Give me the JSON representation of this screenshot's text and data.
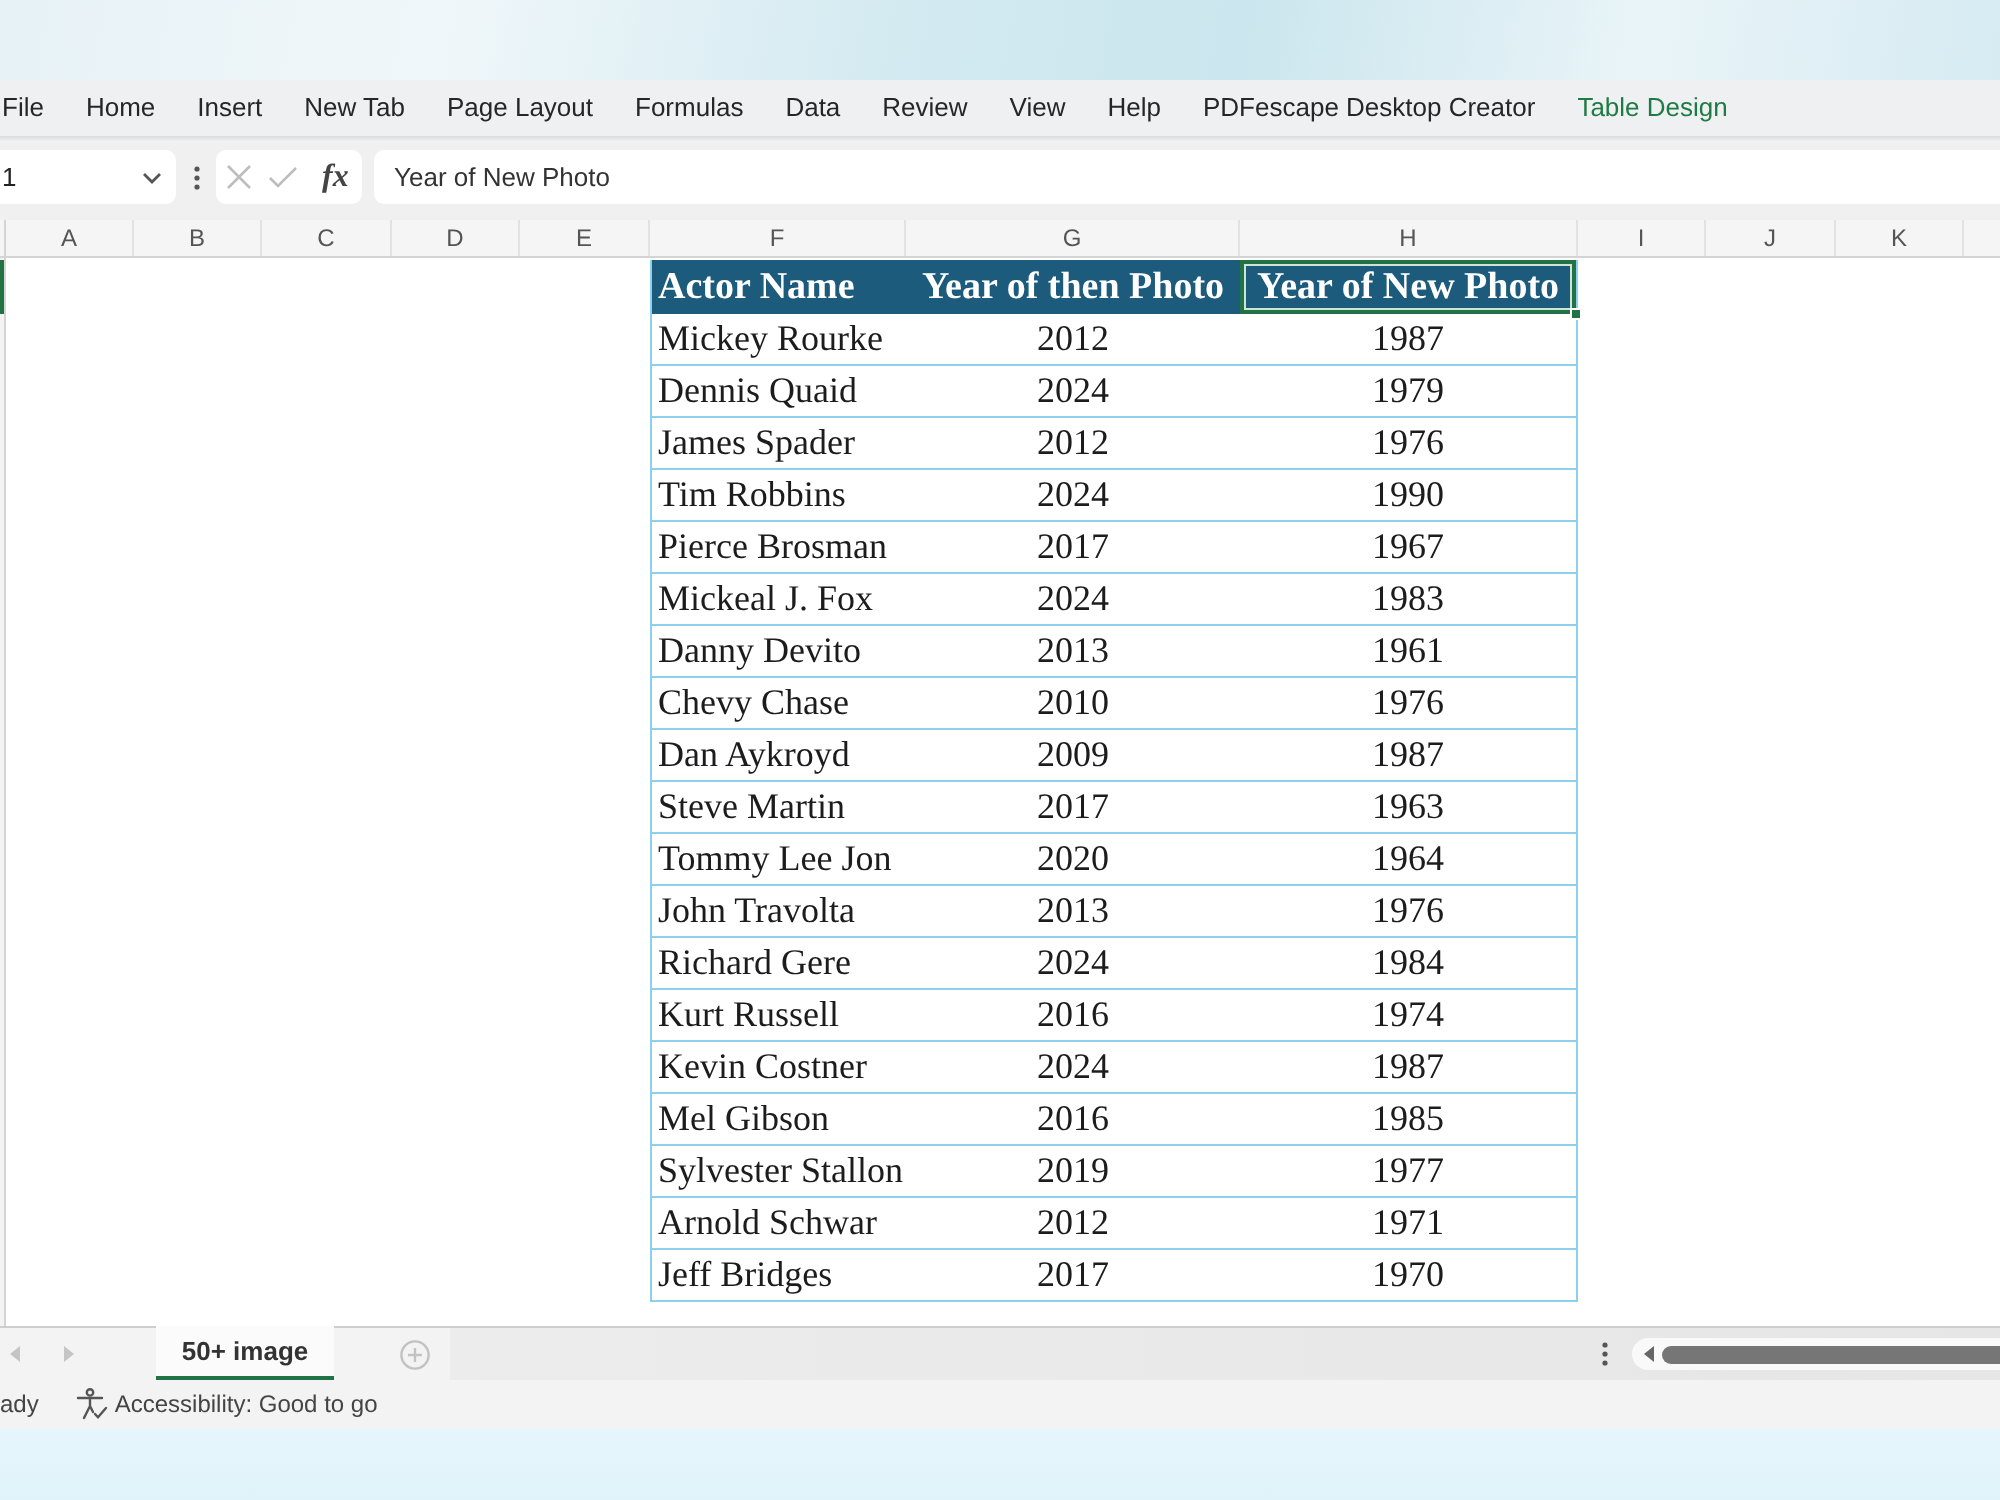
{
  "ribbon": {
    "tabs": [
      {
        "label": "File",
        "kind": "standard"
      },
      {
        "label": "Home",
        "kind": "standard"
      },
      {
        "label": "Insert",
        "kind": "standard"
      },
      {
        "label": "New Tab",
        "kind": "standard"
      },
      {
        "label": "Page Layout",
        "kind": "standard"
      },
      {
        "label": "Formulas",
        "kind": "standard"
      },
      {
        "label": "Data",
        "kind": "standard"
      },
      {
        "label": "Review",
        "kind": "standard"
      },
      {
        "label": "View",
        "kind": "standard"
      },
      {
        "label": "Help",
        "kind": "standard"
      },
      {
        "label": "PDFescape Desktop Creator",
        "kind": "standard"
      },
      {
        "label": "Table Design",
        "kind": "contextual"
      }
    ]
  },
  "formula_bar": {
    "name_box": "1",
    "function_label": "fx",
    "formula": "Year of New Photo"
  },
  "grid": {
    "column_letters": [
      "A",
      "B",
      "C",
      "D",
      "E",
      "F",
      "G",
      "H",
      "I",
      "J",
      "K"
    ]
  },
  "table": {
    "columns": [
      {
        "label": "Actor Name",
        "selected": false
      },
      {
        "label": "Year of then Photo",
        "selected": false
      },
      {
        "label": "Year of New Photo",
        "selected": true
      }
    ],
    "rows": [
      [
        "Mickey Rourke",
        "2012",
        "1987"
      ],
      [
        "Dennis Quaid",
        "2024",
        "1979"
      ],
      [
        "James Spader",
        "2012",
        "1976"
      ],
      [
        "Tim Robbins",
        "2024",
        "1990"
      ],
      [
        "Pierce Brosman",
        "2017",
        "1967"
      ],
      [
        "Mickeal J. Fox",
        "2024",
        "1983"
      ],
      [
        "Danny Devito",
        "2013",
        "1961"
      ],
      [
        "Chevy Chase",
        "2010",
        "1976"
      ],
      [
        "Dan Aykroyd",
        "2009",
        "1987"
      ],
      [
        "Steve Martin",
        "2017",
        "1963"
      ],
      [
        "Tommy Lee Jon",
        "2020",
        "1964"
      ],
      [
        "John Travolta",
        "2013",
        "1976"
      ],
      [
        "Richard Gere",
        "2024",
        "1984"
      ],
      [
        "Kurt Russell",
        "2016",
        "1974"
      ],
      [
        "Kevin Costner",
        "2024",
        "1987"
      ],
      [
        "Mel Gibson",
        "2016",
        "1985"
      ],
      [
        "Sylvester Stallon",
        "2019",
        "1977"
      ],
      [
        "Arnold Schwar",
        "2012",
        "1971"
      ],
      [
        "Jeff Bridges",
        "2017",
        "1970"
      ]
    ]
  },
  "sheet_tabs": [
    {
      "label": "50+ image",
      "selected": true
    }
  ],
  "status_bar": {
    "mode": "ady",
    "accessibility": "Accessibility: Good to go"
  }
}
